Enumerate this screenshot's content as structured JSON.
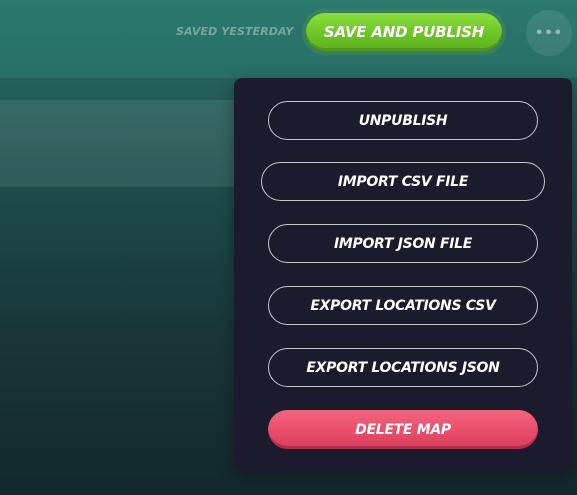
{
  "header": {
    "save_status": "SAVED YESTERDAY",
    "publish_label": "SAVE AND PUBLISH",
    "more_icon": "more-horizontal-icon"
  },
  "menu": {
    "items": [
      {
        "label": "UNPUBLISH"
      },
      {
        "label": "IMPORT CSV FILE"
      },
      {
        "label": "IMPORT JSON FILE"
      },
      {
        "label": "EXPORT LOCATIONS CSV"
      },
      {
        "label": "EXPORT LOCATIONS JSON"
      },
      {
        "label": "DELETE MAP"
      }
    ]
  },
  "colors": {
    "publish_green": "#6cc426",
    "delete_red": "#e94d6a",
    "menu_bg": "#1b1b2d",
    "page_teal": "#2a6f66"
  }
}
